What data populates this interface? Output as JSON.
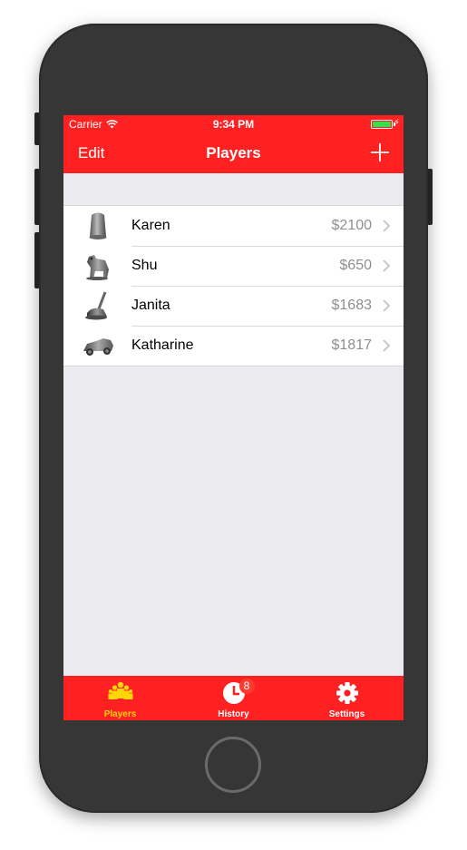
{
  "status_bar": {
    "carrier": "Carrier",
    "time": "9:34 PM",
    "battery_level": 1.0
  },
  "nav": {
    "left_button": "Edit",
    "title": "Players",
    "right_icon": "plus-icon"
  },
  "players": [
    {
      "name": "Karen",
      "amount": "$2100",
      "token": "thimble-icon"
    },
    {
      "name": "Shu",
      "amount": "$650",
      "token": "dog-icon"
    },
    {
      "name": "Janita",
      "amount": "$1683",
      "token": "iron-icon"
    },
    {
      "name": "Katharine",
      "amount": "$1817",
      "token": "car-icon"
    }
  ],
  "tabs": [
    {
      "label": "Players",
      "icon": "players-group-icon",
      "active": true
    },
    {
      "label": "History",
      "icon": "clock-icon",
      "badge": "8"
    },
    {
      "label": "Settings",
      "icon": "gear-icon"
    }
  ],
  "colors": {
    "brand_red": "#ff2121",
    "active_tab": "#ffd60a",
    "background": "#ebebf0",
    "battery": "#3ddc4a"
  }
}
